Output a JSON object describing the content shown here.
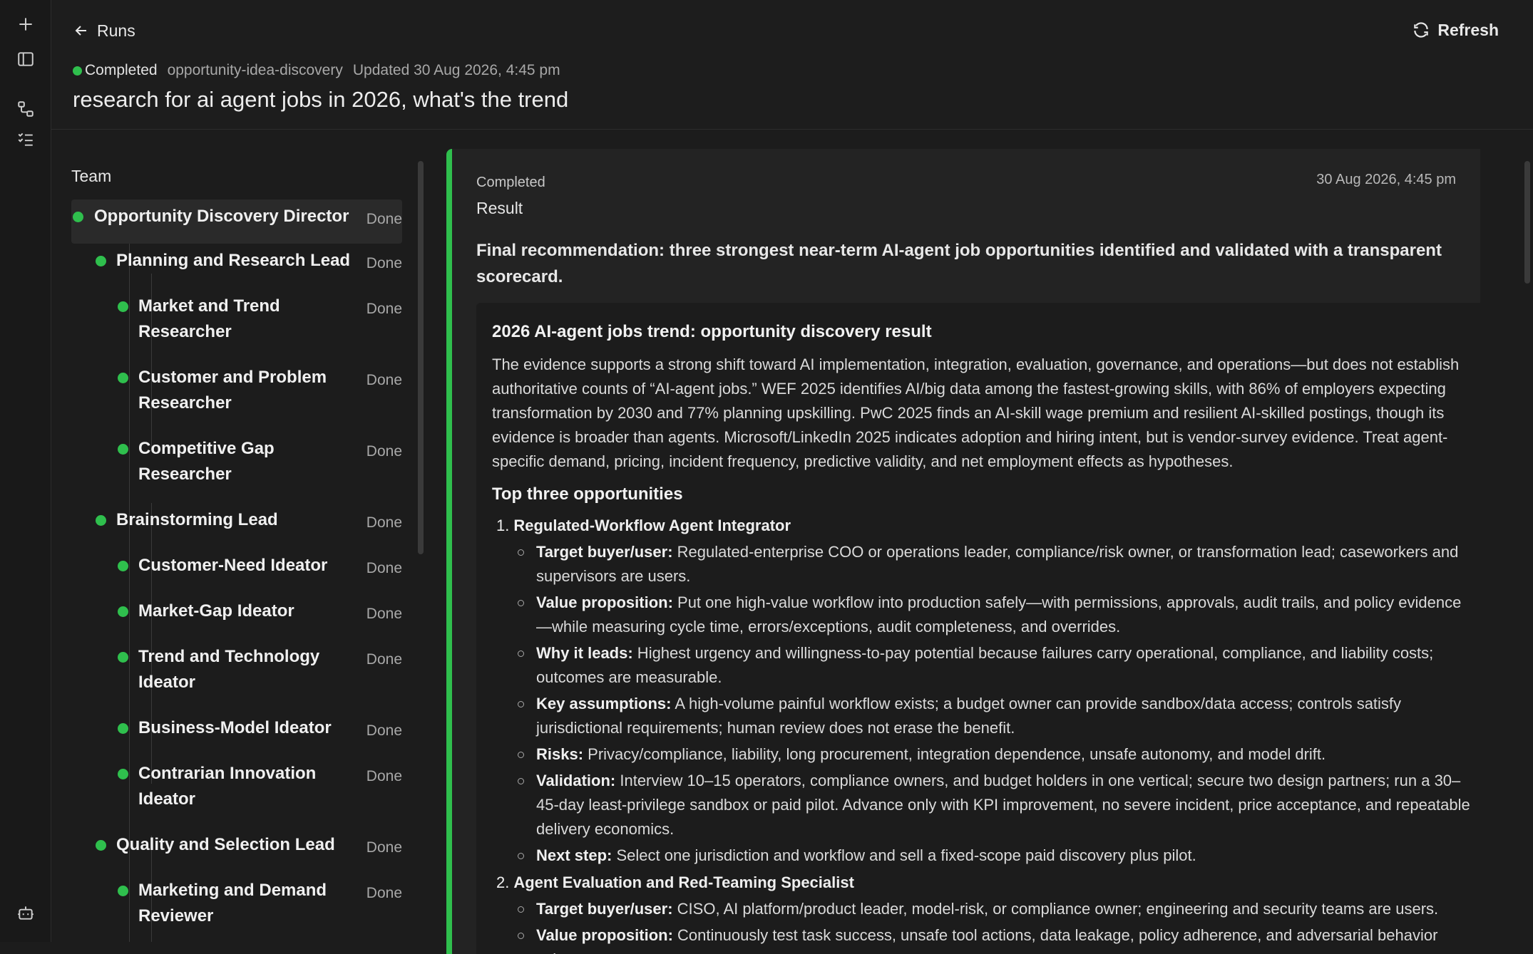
{
  "rail": {
    "icons": [
      "plus-icon",
      "sidebar-toggle-icon",
      "workflow-icon",
      "checklist-icon",
      "robot-icon"
    ]
  },
  "header": {
    "back_label": "Runs",
    "refresh_label": "Refresh",
    "status": "Completed",
    "workflow_slug": "opportunity-idea-discovery",
    "updated": "Updated 30 Aug 2026, 4:45 pm",
    "title": "research for ai agent jobs in 2026, what's the trend"
  },
  "team": {
    "heading": "Team",
    "members": [
      {
        "name": "Opportunity Discovery Director",
        "state": "Done",
        "level": 0
      },
      {
        "name": "Planning and Research Lead",
        "state": "Done",
        "level": 1
      },
      {
        "name": "Market and Trend Researcher",
        "state": "Done",
        "level": 2
      },
      {
        "name": "Customer and Problem Researcher",
        "state": "Done",
        "level": 2
      },
      {
        "name": "Competitive Gap Researcher",
        "state": "Done",
        "level": 2
      },
      {
        "name": "Brainstorming Lead",
        "state": "Done",
        "level": 1
      },
      {
        "name": "Customer-Need Ideator",
        "state": "Done",
        "level": 2
      },
      {
        "name": "Market-Gap Ideator",
        "state": "Done",
        "level": 2
      },
      {
        "name": "Trend and Technology Ideator",
        "state": "Done",
        "level": 2
      },
      {
        "name": "Business-Model Ideator",
        "state": "Done",
        "level": 2
      },
      {
        "name": "Contrarian Innovation Ideator",
        "state": "Done",
        "level": 2
      },
      {
        "name": "Quality and Selection Lead",
        "state": "Done",
        "level": 1
      },
      {
        "name": "Marketing and Demand Reviewer",
        "state": "Done",
        "level": 2
      }
    ]
  },
  "result": {
    "status": "Completed",
    "label": "Result",
    "timestamp": "30 Aug 2026, 4:45 pm",
    "summary": "Final recommendation: three strongest near-term AI-agent job opportunities identified and validated with a transparent scorecard.",
    "doc": {
      "heading": "2026 AI-agent jobs trend: opportunity discovery result",
      "intro": "The evidence supports a strong shift toward AI implementation, integration, evaluation, governance, and operations—but does not establish authoritative counts of “AI-agent jobs.” WEF 2025 identifies AI/big data among the fastest-growing skills, with 86% of employers expecting transformation by 2030 and 77% planning upskilling. PwC 2025 finds an AI-skill wage premium and resilient AI-skilled postings, though its evidence is broader than agents. Microsoft/LinkedIn 2025 indicates adoption and hiring intent, but is vendor-survey evidence. Treat agent-specific demand, pricing, incident frequency, predictive validity, and net employment effects as hypotheses.",
      "section_heading": "Top three opportunities",
      "opportunities": [
        {
          "num": "1.",
          "title": "Regulated-Workflow Agent Integrator",
          "bullets": [
            {
              "label": "Target buyer/user:",
              "text": " Regulated-enterprise COO or operations leader, compliance/risk owner, or transformation lead; caseworkers and supervisors are users."
            },
            {
              "label": "Value proposition:",
              "text": " Put one high-value workflow into production safely—with permissions, approvals, audit trails, and policy evidence—while measuring cycle time, errors/exceptions, audit completeness, and overrides."
            },
            {
              "label": "Why it leads:",
              "text": " Highest urgency and willingness-to-pay potential because failures carry operational, compliance, and liability costs; outcomes are measurable."
            },
            {
              "label": "Key assumptions:",
              "text": " A high-volume painful workflow exists; a budget owner can provide sandbox/data access; controls satisfy jurisdictional requirements; human review does not erase the benefit."
            },
            {
              "label": "Risks:",
              "text": " Privacy/compliance, liability, long procurement, integration dependence, unsafe autonomy, and model drift."
            },
            {
              "label": "Validation:",
              "text": " Interview 10–15 operators, compliance owners, and budget holders in one vertical; secure two design partners; run a 30–45-day least-privilege sandbox or paid pilot. Advance only with KPI improvement, no severe incident, price acceptance, and repeatable delivery economics."
            },
            {
              "label": "Next step:",
              "text": " Select one jurisdiction and workflow and sell a fixed-scope paid discovery plus pilot."
            }
          ]
        },
        {
          "num": "2.",
          "title": "Agent Evaluation and Red-Teaming Specialist",
          "bullets": [
            {
              "label": "Target buyer/user:",
              "text": " CISO, AI platform/product leader, model-risk, or compliance owner; engineering and security teams are users."
            },
            {
              "label": "Value proposition:",
              "text": " Continuously test task success, unsafe tool actions, data leakage, policy adherence, and adversarial behavior using"
            }
          ]
        }
      ]
    }
  }
}
